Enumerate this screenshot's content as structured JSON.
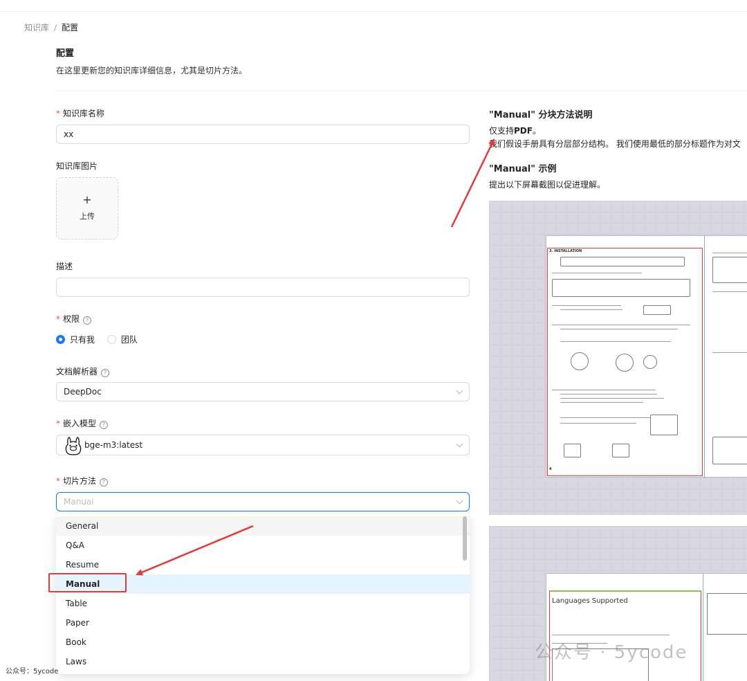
{
  "breadcrumb": {
    "root": "知识库",
    "separator": "/",
    "current": "配置"
  },
  "header": {
    "title": "配置",
    "description": "在这里更新您的知识库详细信息，尤其是切片方法。"
  },
  "form": {
    "name": {
      "label": "知识库名称",
      "value": "xx"
    },
    "image": {
      "label": "知识库图片",
      "upload_label": "上传"
    },
    "description": {
      "label": "描述",
      "value": ""
    },
    "permission": {
      "label": "权限",
      "options": [
        "只有我",
        "团队"
      ],
      "selected": "只有我"
    },
    "parser": {
      "label": "文档解析器",
      "value": "DeepDoc"
    },
    "embedding": {
      "label": "嵌入模型",
      "value": "bge-m3:latest"
    },
    "chunk_method": {
      "label": "切片方法",
      "placeholder": "Manual",
      "options": [
        "General",
        "Q&A",
        "Resume",
        "Manual",
        "Table",
        "Paper",
        "Book",
        "Laws"
      ],
      "selected": "Manual",
      "hovered": "General"
    }
  },
  "right_panel": {
    "heading": "\"Manual\" 分块方法说明",
    "support_prefix": "仅支持",
    "support_format": "PDF",
    "support_suffix": "。",
    "assumption": "我们假设手册具有分层部分结构。 我们使用最低的部分标题作为对文",
    "example_heading": "\"Manual\" 示例",
    "example_desc": "提出以下屏幕截图以促进理解。",
    "sample1_section": "3. INSTALLATION",
    "sample1_page": "4",
    "sample2_title": "Languages Supported"
  },
  "footer": {
    "source_note": "公众号：5ycode",
    "watermark": "公众号 · 5ycode"
  },
  "colors": {
    "primary": "#1677ff",
    "required": "#ff4d4f",
    "annotation": "#e53935"
  }
}
